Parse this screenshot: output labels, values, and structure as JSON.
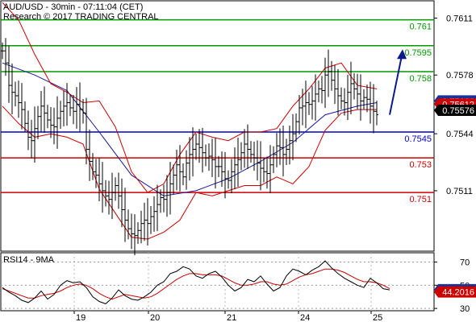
{
  "header": {
    "title": "AUD/USD - 30min - 07:11:04 (CET)",
    "subtitle": "Research © 2017 TRADING CENTRAL"
  },
  "colors": {
    "price": "#000000",
    "bollinger": "#cc0000",
    "moving_average": "#1a1a99",
    "resistance": "#009900",
    "pivot": "#0000cc",
    "support": "#cc0000",
    "arrow": "#0a1a8a",
    "rsi": "#000000",
    "rsi_ma": "#cc0000",
    "badge_blue": "#1a3399",
    "badge_red": "#cc0000",
    "badge_black": "#000000"
  },
  "chart_data": [
    {
      "type": "line",
      "title": "AUD/USD - 30min",
      "ylim": [
        0.7476,
        0.7621
      ],
      "y_ticks": [
        0.7611,
        0.7578,
        0.7544,
        0.7511
      ],
      "x_ticks": [
        "19",
        "20",
        "21",
        "24",
        "25"
      ],
      "levels": [
        {
          "value": 0.761,
          "label": "0.761",
          "kind": "resistance"
        },
        {
          "value": 0.7595,
          "label": "0.7595",
          "kind": "resistance"
        },
        {
          "value": 0.758,
          "label": "0.758",
          "kind": "resistance"
        },
        {
          "value": 0.7545,
          "label": "0.7545",
          "kind": "pivot"
        },
        {
          "value": 0.753,
          "label": "0.753",
          "kind": "support"
        },
        {
          "value": 0.751,
          "label": "0.751",
          "kind": "support"
        }
      ],
      "price_badges": [
        {
          "value": 0.7563,
          "label": "0.75630",
          "kind": "blue"
        },
        {
          "value": 0.75612,
          "label": "0.75612",
          "kind": "red"
        },
        {
          "value": 0.75576,
          "label": "0.75576",
          "kind": "black"
        }
      ],
      "series": [
        {
          "kind": "price",
          "x": [
            0,
            4,
            8,
            12,
            16,
            20,
            24,
            28,
            32,
            36,
            40,
            44,
            48,
            52,
            56,
            60,
            64,
            68,
            72,
            76,
            80,
            84,
            88,
            92,
            96,
            100,
            104,
            108,
            112,
            116,
            120,
            124,
            128,
            132,
            136,
            140,
            144,
            148,
            152,
            156,
            160,
            164,
            168,
            172,
            176,
            180,
            184,
            188,
            192,
            196,
            200,
            204,
            208,
            212,
            216,
            220,
            224,
            228,
            232,
            236,
            240,
            244,
            248,
            252,
            256,
            260,
            264,
            268,
            272,
            276,
            280,
            284,
            288,
            292,
            296,
            300,
            304,
            308,
            312,
            316,
            320,
            324,
            328,
            332,
            336,
            340,
            344,
            348,
            352,
            356,
            360,
            364,
            368,
            372,
            376,
            380,
            384,
            388,
            392,
            396,
            400,
            404,
            408,
            412,
            416,
            420,
            424,
            428,
            432,
            436,
            440,
            444,
            448,
            452,
            456,
            460,
            464
          ],
          "values": [
            0.7592,
            0.7585,
            0.7572,
            0.7568,
            0.7566,
            0.7562,
            0.7558,
            0.755,
            0.7542,
            0.754,
            0.7547,
            0.7554,
            0.756,
            0.7556,
            0.7552,
            0.7549,
            0.7548,
            0.7553,
            0.7557,
            0.756,
            0.7562,
            0.7559,
            0.7557,
            0.7561,
            0.7558,
            0.7556,
            0.7535,
            0.7528,
            0.7522,
            0.752,
            0.7515,
            0.7511,
            0.7508,
            0.7506,
            0.751,
            0.7514,
            0.7508,
            0.75,
            0.7494,
            0.7489,
            0.7486,
            0.7485,
            0.7488,
            0.7492,
            0.7494,
            0.7492,
            0.7496,
            0.7499,
            0.7503,
            0.7507,
            0.7506,
            0.751,
            0.7515,
            0.752,
            0.7526,
            0.7522,
            0.7519,
            0.7527,
            0.7532,
            0.7535,
            0.7538,
            0.7536,
            0.7533,
            0.753,
            0.7531,
            0.7529,
            0.7525,
            0.7525,
            0.7522,
            0.7518,
            0.7517,
            0.7522,
            0.7526,
            0.7529,
            0.7533,
            0.7538,
            0.7535,
            0.7532,
            0.753,
            0.7527,
            0.7524,
            0.7522,
            0.7521,
            0.7526,
            0.7532,
            0.7537,
            0.7536,
            0.7532,
            0.7535,
            0.754,
            0.7544,
            0.7551,
            0.7559,
            0.756,
            0.7562,
            0.7561,
            0.7563,
            0.7567,
            0.757,
            0.7569,
            0.7578,
            0.758,
            0.7575,
            0.757,
            0.7566,
            0.7563,
            0.7562,
            0.7568,
            0.7573,
            0.757,
            0.7567,
            0.7563,
            0.7565,
            0.7564,
            0.756,
            0.7557,
            0.7555
          ]
        },
        {
          "kind": "moving_average",
          "x": [
            0,
            40,
            80,
            120,
            160,
            200,
            240,
            280,
            320,
            360,
            400,
            440,
            464
          ],
          "values": [
            0.7585,
            0.7578,
            0.7569,
            0.7545,
            0.752,
            0.7508,
            0.7511,
            0.7518,
            0.7528,
            0.7539,
            0.7555,
            0.756,
            0.7562
          ]
        },
        {
          "kind": "bollinger_upper",
          "x": [
            0,
            20,
            40,
            60,
            80,
            100,
            120,
            140,
            160,
            180,
            200,
            220,
            240,
            260,
            280,
            300,
            320,
            340,
            360,
            380,
            400,
            420,
            440,
            464
          ],
          "values": [
            0.762,
            0.761,
            0.759,
            0.7573,
            0.7568,
            0.7562,
            0.7563,
            0.7548,
            0.7522,
            0.751,
            0.7515,
            0.7532,
            0.7545,
            0.7542,
            0.754,
            0.7545,
            0.7545,
            0.7547,
            0.756,
            0.757,
            0.7582,
            0.7585,
            0.7572,
            0.757
          ]
        },
        {
          "kind": "bollinger_lower",
          "x": [
            0,
            20,
            40,
            60,
            80,
            100,
            120,
            140,
            160,
            180,
            200,
            220,
            240,
            260,
            280,
            300,
            320,
            340,
            360,
            380,
            400,
            420,
            440,
            464
          ],
          "values": [
            0.756,
            0.755,
            0.7542,
            0.7544,
            0.7542,
            0.7538,
            0.7512,
            0.7498,
            0.7484,
            0.7483,
            0.7487,
            0.7494,
            0.751,
            0.7508,
            0.7511,
            0.7514,
            0.7514,
            0.7519,
            0.7515,
            0.7525,
            0.7546,
            0.7556,
            0.7558,
            0.7558
          ]
        }
      ],
      "forecast_arrow": {
        "x_start": 483,
        "y_start": 0.7555,
        "x_end": 498,
        "y_end": 0.7592
      }
    },
    {
      "type": "line",
      "title": "RSI14 - 9MA",
      "ylim": [
        28,
        78
      ],
      "y_ticks": [
        70,
        50,
        30
      ],
      "x_ticks": [
        "19",
        "20",
        "21",
        "24",
        "25"
      ],
      "value_badges": [
        {
          "value": 46.1728,
          "label": "46.1728",
          "kind": "blue"
        },
        {
          "value": 44.2016,
          "label": "44.2016",
          "kind": "red"
        }
      ],
      "series": [
        {
          "kind": "rsi",
          "x": [
            0,
            8,
            16,
            24,
            32,
            40,
            48,
            56,
            64,
            72,
            80,
            88,
            96,
            104,
            112,
            120,
            128,
            136,
            144,
            152,
            160,
            168,
            176,
            184,
            192,
            200,
            208,
            216,
            224,
            232,
            240,
            248,
            256,
            264,
            272,
            280,
            288,
            296,
            304,
            312,
            320,
            328,
            336,
            344,
            352,
            360,
            368,
            376,
            384,
            392,
            400,
            408,
            416,
            424,
            432,
            440,
            448,
            456,
            464,
            472,
            480
          ],
          "values": [
            48,
            44,
            41,
            37,
            35,
            39,
            45,
            38,
            42,
            50,
            54,
            52,
            53,
            48,
            40,
            36,
            34,
            39,
            46,
            41,
            38,
            37,
            40,
            44,
            50,
            53,
            60,
            62,
            66,
            64,
            58,
            56,
            60,
            62,
            57,
            50,
            45,
            48,
            55,
            53,
            58,
            51,
            45,
            48,
            58,
            64,
            62,
            59,
            63,
            66,
            71,
            65,
            60,
            56,
            53,
            50,
            48,
            56,
            52,
            47,
            46
          ]
        },
        {
          "kind": "rsi_ma",
          "x": [
            0,
            8,
            16,
            24,
            32,
            40,
            48,
            56,
            64,
            72,
            80,
            88,
            96,
            104,
            112,
            120,
            128,
            136,
            144,
            152,
            160,
            168,
            176,
            184,
            192,
            200,
            208,
            216,
            224,
            232,
            240,
            248,
            256,
            264,
            272,
            280,
            288,
            296,
            304,
            312,
            320,
            328,
            336,
            344,
            352,
            360,
            368,
            376,
            384,
            392,
            400,
            408,
            416,
            424,
            432,
            440,
            448,
            456,
            464,
            472,
            480
          ],
          "values": [
            47,
            45,
            43,
            41,
            39,
            39,
            41,
            42,
            43,
            45,
            48,
            50,
            51,
            50,
            47,
            43,
            40,
            38,
            40,
            42,
            41,
            40,
            39,
            40,
            43,
            47,
            51,
            55,
            58,
            60,
            60,
            59,
            59,
            59,
            58,
            55,
            52,
            50,
            50,
            51,
            53,
            53,
            51,
            50,
            51,
            54,
            57,
            59,
            60,
            62,
            64,
            64,
            63,
            61,
            58,
            55,
            53,
            53,
            52,
            50,
            47
          ]
        }
      ]
    }
  ]
}
